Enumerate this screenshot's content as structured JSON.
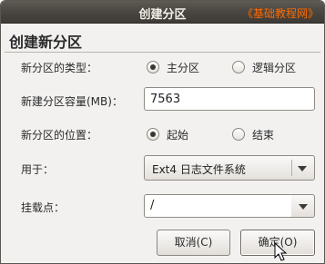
{
  "window": {
    "title": "创建分区",
    "watermark": "《基础教程网》"
  },
  "dialog": {
    "heading": "创建新分区"
  },
  "form": {
    "type": {
      "label": "新分区的类型：",
      "options": [
        "主分区",
        "逻辑分区"
      ],
      "selected": "主分区"
    },
    "size": {
      "label": "新建分区容量(MB)：",
      "value": "7563"
    },
    "location": {
      "label": "新分区的位置：",
      "options": [
        "起始",
        "结束"
      ],
      "selected": "起始"
    },
    "use_as": {
      "label": "用于：",
      "value": "Ext4 日志文件系统"
    },
    "mount_point": {
      "label": "挂载点：",
      "value": "/"
    }
  },
  "buttons": {
    "cancel": "取消(C)",
    "ok": "确定(O)"
  },
  "icons": {
    "dropdown": "chevron-down-icon",
    "pointer": "mouse-pointer-icon"
  }
}
